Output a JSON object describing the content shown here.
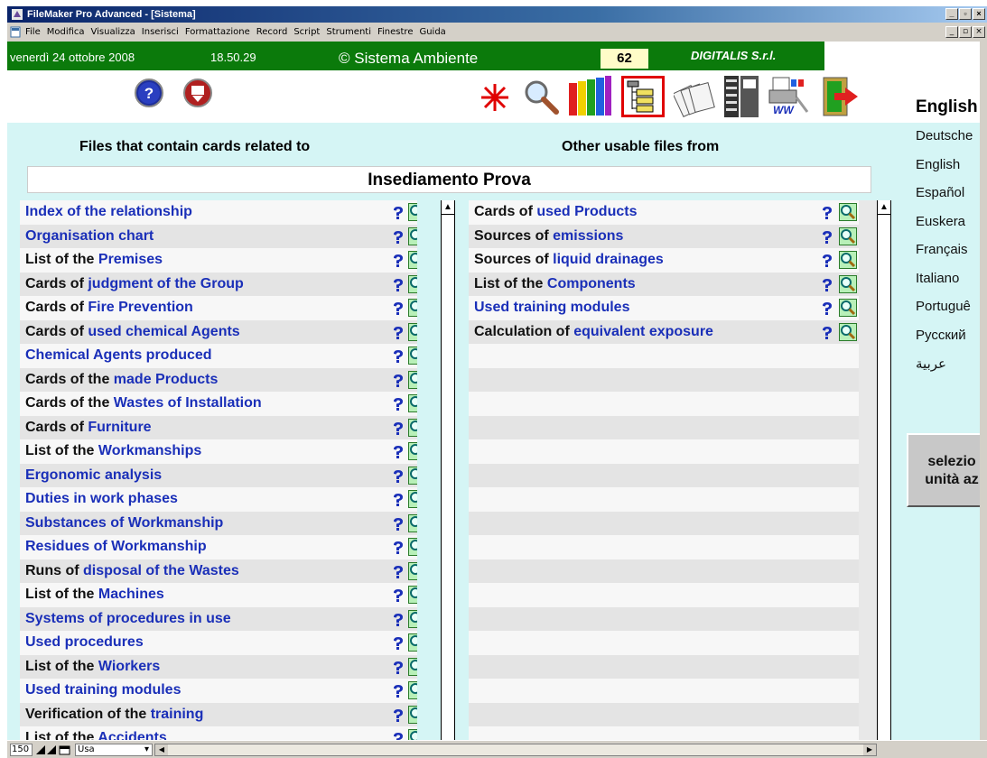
{
  "window": {
    "title": "FileMaker Pro Advanced - [Sistema]"
  },
  "menu": [
    "File",
    "Modifica",
    "Visualizza",
    "Inserisci",
    "Formattazione",
    "Record",
    "Script",
    "Strumenti",
    "Finestre",
    "Guida"
  ],
  "header": {
    "date": "venerdì 24 ottobre 2008",
    "time": "18.50.29",
    "copyright": "© Sistema Ambiente",
    "counter": "62",
    "company": "DIGITALIS S.r.l."
  },
  "content": {
    "left_heading": "Files that contain cards related to",
    "right_heading": "Other usable files from",
    "subject": "Insediamento Prova",
    "left_items": [
      {
        "pre": "",
        "link": "Index of the relationship"
      },
      {
        "pre": "",
        "link": "Organisation chart"
      },
      {
        "pre": "List of the ",
        "link": "Premises"
      },
      {
        "pre": "Cards of ",
        "link": "judgment of the Group"
      },
      {
        "pre": "Cards of ",
        "link": "Fire Prevention"
      },
      {
        "pre": "Cards of ",
        "link": "used chemical Agents"
      },
      {
        "pre": "",
        "link": "Chemical Agents produced"
      },
      {
        "pre": "Cards of the ",
        "link": "made Products"
      },
      {
        "pre": "Cards of the ",
        "link": "Wastes of Installation"
      },
      {
        "pre": "Cards of ",
        "link": " Furniture"
      },
      {
        "pre": "List of the ",
        "link": "Workmanships"
      },
      {
        "pre": "",
        "link": "Ergonomic analysis"
      },
      {
        "pre": "",
        "link": "Duties in work phases"
      },
      {
        "pre": "",
        "link": "Substances of Workmanship"
      },
      {
        "pre": "",
        "link": "Residues of Workmanship"
      },
      {
        "pre": "Runs of ",
        "link": "disposal of the Wastes"
      },
      {
        "pre": "List of the ",
        "link": "Machines"
      },
      {
        "pre": "",
        "link": "Systems of procedures in use"
      },
      {
        "pre": "",
        "link": "Used procedures"
      },
      {
        "pre": "List of the ",
        "link": "Wiorkers"
      },
      {
        "pre": "",
        "link": "Used training modules"
      },
      {
        "pre": "Verification of the ",
        "link": "training"
      },
      {
        "pre": "List of the ",
        "link": "Accidents"
      }
    ],
    "right_items": [
      {
        "pre": "Cards of ",
        "link": "used Products"
      },
      {
        "pre": "Sources of ",
        "link": "emissions"
      },
      {
        "pre": "Sources of ",
        "link": "liquid drainages"
      },
      {
        "pre": "List of the ",
        "link": "Components"
      },
      {
        "pre": "",
        "link": "Used training modules"
      },
      {
        "pre": "Calculation of ",
        "link": "equivalent exposure"
      }
    ],
    "right_empty_rows": 17
  },
  "languages": {
    "title": "English",
    "items": [
      "Deutsche",
      "English",
      "Español",
      "Euskera",
      "Français",
      "Italiano",
      "Portuguê",
      "Русский",
      "عربية"
    ]
  },
  "select_button": {
    "line1": "selezio",
    "line2": "unità az"
  },
  "status": {
    "zoom": "150",
    "mode": "Usa"
  },
  "colors": {
    "green_bar": "#0b7a0b",
    "content_bg": "#d5f5f5",
    "link": "#1a2fb8"
  }
}
